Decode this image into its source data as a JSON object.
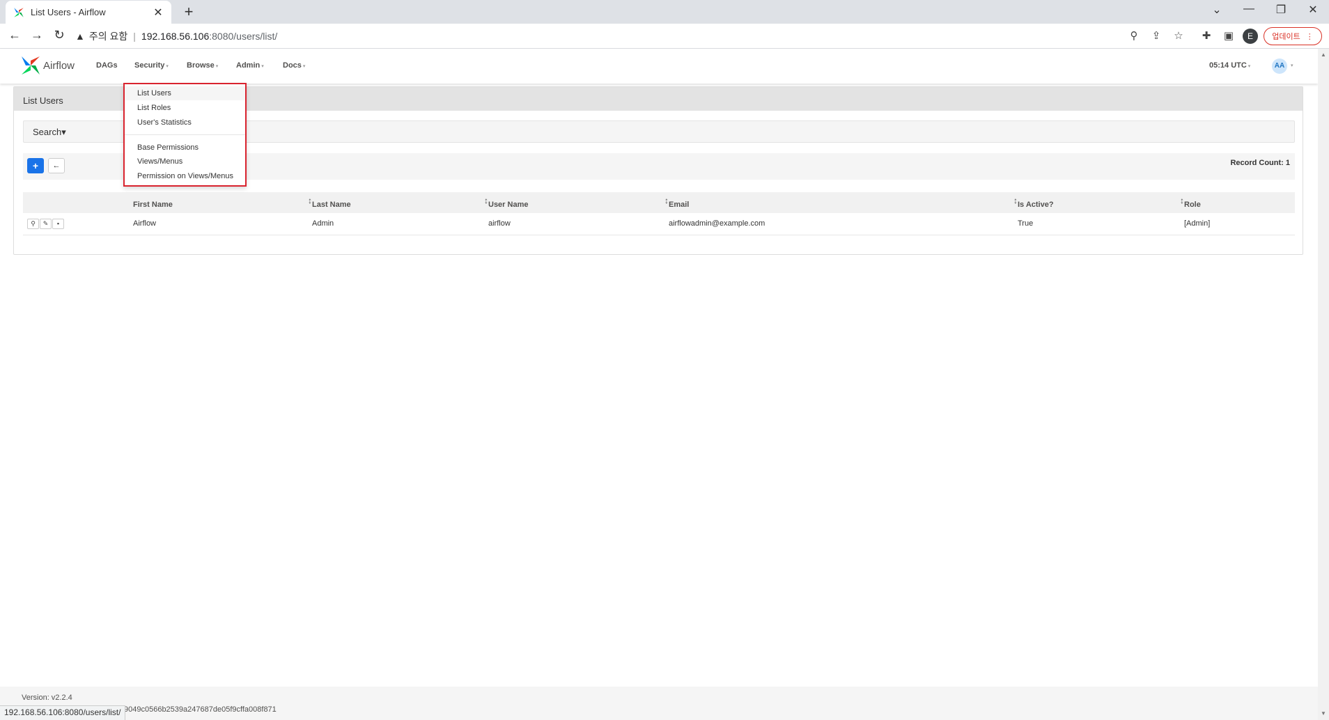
{
  "browser": {
    "tab_title": "List Users - Airflow",
    "new_tab": "+",
    "security_warning": "주의 요함",
    "url_host": "192.168.56.106",
    "url_rest": ":8080/users/list/",
    "profile_initial": "E",
    "update_label": "업데이트",
    "status_url": "192.168.56.106:8080/users/list/"
  },
  "navbar": {
    "brand": "Airflow",
    "items": [
      "DAGs",
      "Security",
      "Browse",
      "Admin",
      "Docs"
    ],
    "clock": "05:14 UTC",
    "avatar": "AA"
  },
  "security_menu": {
    "items": [
      "List Users",
      "List Roles",
      "User's Statistics",
      "Base Permissions",
      "Views/Menus",
      "Permission on Views/Menus"
    ]
  },
  "panel": {
    "title": "List Users",
    "search_label": "Search",
    "record_count": "Record Count: 1"
  },
  "table": {
    "headers": [
      "First Name",
      "Last Name",
      "User Name",
      "Email",
      "Is Active?",
      "Role"
    ],
    "rows": [
      [
        "Airflow",
        "Admin",
        "airflow",
        "airflowadmin@example.com",
        "True",
        "[Admin]"
      ]
    ]
  },
  "footer": {
    "version": "Version: v2.2.4",
    "git": "9049c0566b2539a247687de05f9cffa008f871"
  },
  "colors": {
    "primary": "#1a73e8",
    "highlight_border": "#d9232e",
    "update_red": "#d93025"
  }
}
